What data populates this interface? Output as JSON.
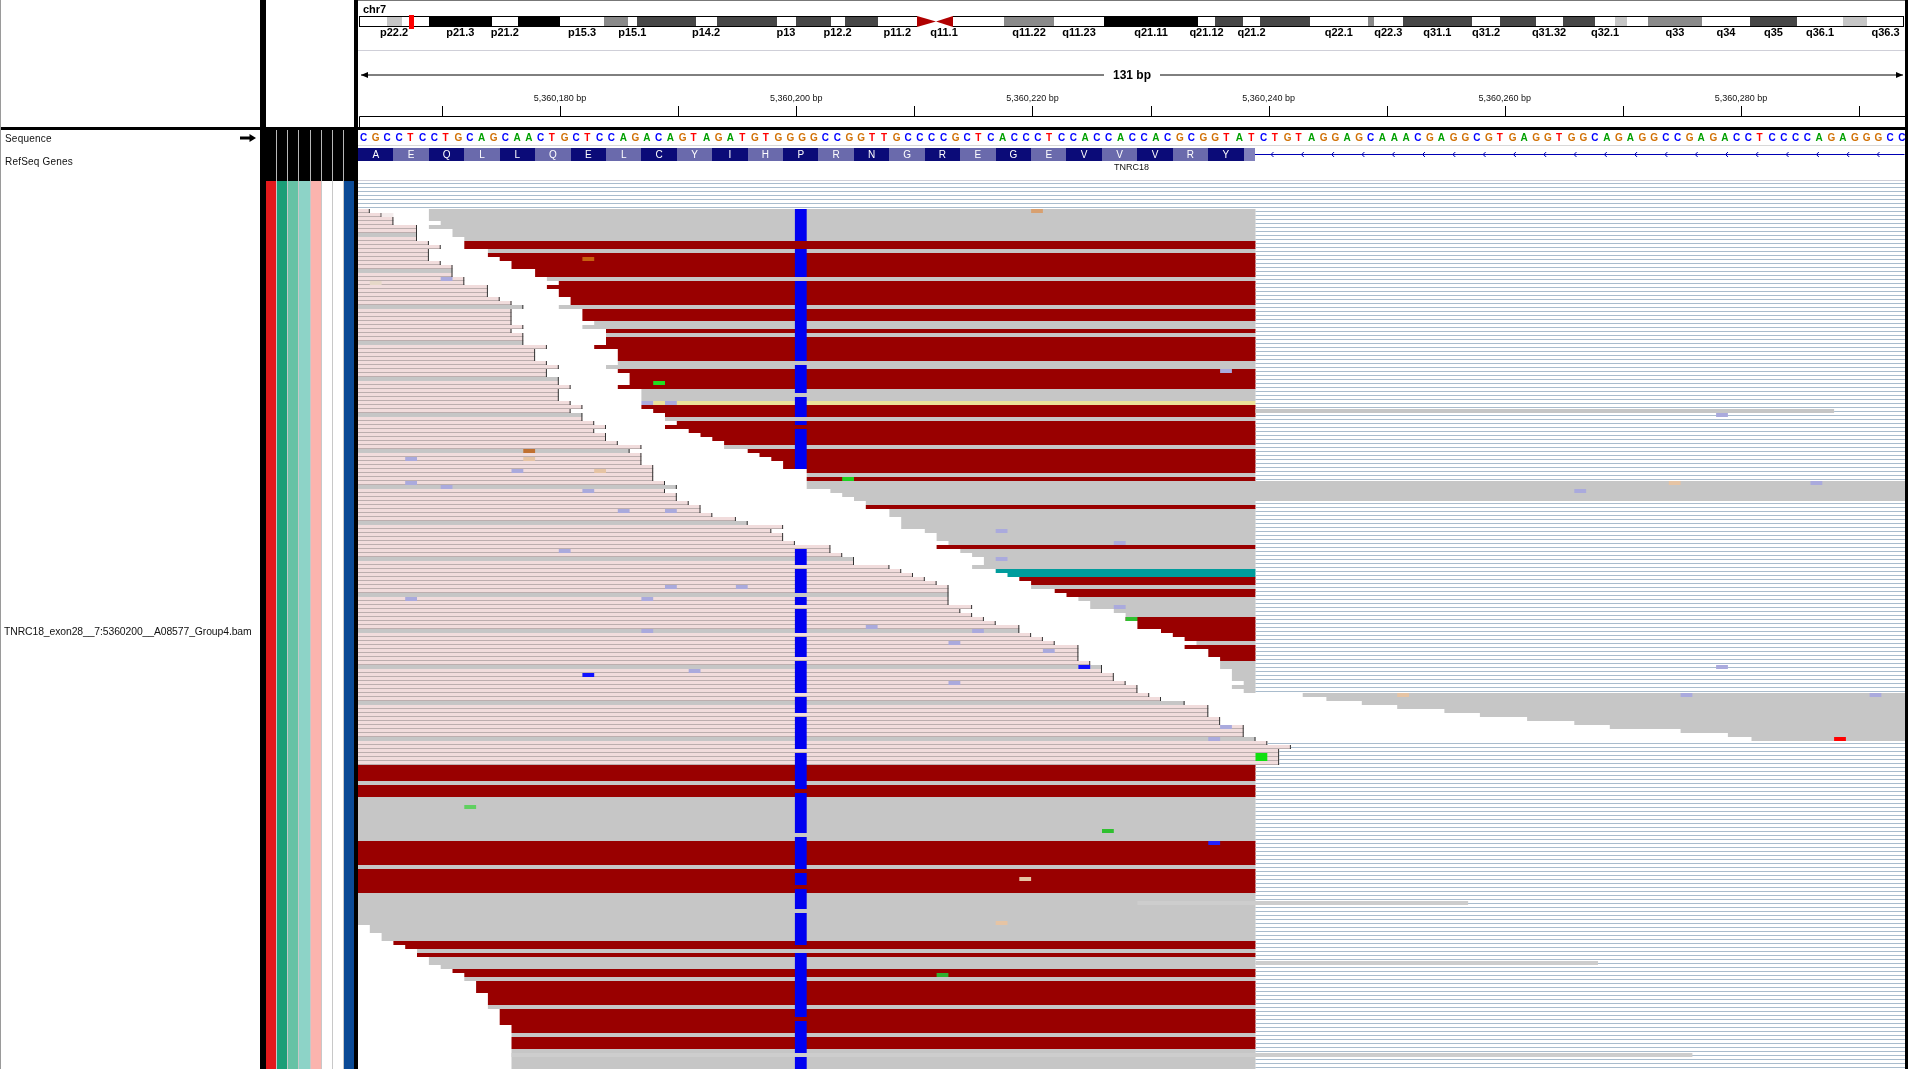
{
  "ideogram": {
    "chromosome": "chr7",
    "bands": [
      {
        "kind": "gneg"
      },
      {
        "kind": "gpos25",
        "label": "p22.2"
      },
      {
        "kind": "gneg"
      },
      {
        "kind": "gpos100",
        "label": "p21.3"
      },
      {
        "kind": "gneg",
        "label": "p21.2"
      },
      {
        "kind": "gpos100"
      },
      {
        "kind": "gneg",
        "label": "p15.3"
      },
      {
        "kind": "gpos50"
      },
      {
        "kind": "gneg",
        "label": "p15.1"
      },
      {
        "kind": "gpos75"
      },
      {
        "kind": "gneg",
        "label": "p14.2"
      },
      {
        "kind": "gpos75"
      },
      {
        "kind": "gneg",
        "label": "p13"
      },
      {
        "kind": "gpos75"
      },
      {
        "kind": "gneg",
        "label": "p12.2"
      },
      {
        "kind": "gpos75"
      },
      {
        "kind": "gneg",
        "label": "p11.2"
      },
      {
        "kind": "acen"
      },
      {
        "kind": "acen",
        "label": "q11.1"
      },
      {
        "kind": "gneg"
      },
      {
        "kind": "gpos50",
        "label": "q11.22"
      },
      {
        "kind": "gneg",
        "label": "q11.23"
      },
      {
        "kind": "gpos100",
        "label": "q21.11"
      },
      {
        "kind": "gneg",
        "label": "q21.12"
      },
      {
        "kind": "gpos75"
      },
      {
        "kind": "gneg",
        "label": "q21.2"
      },
      {
        "kind": "gpos75"
      },
      {
        "kind": "gneg",
        "label": "q22.1"
      },
      {
        "kind": "gpos50"
      },
      {
        "kind": "gneg",
        "label": "q22.3"
      },
      {
        "kind": "gpos75",
        "label": "q31.1"
      },
      {
        "kind": "gneg",
        "label": "q31.2"
      },
      {
        "kind": "gpos75"
      },
      {
        "kind": "gneg",
        "label": "q31.32"
      },
      {
        "kind": "gpos75"
      },
      {
        "kind": "gneg",
        "label": "q32.1"
      },
      {
        "kind": "gpos25"
      },
      {
        "kind": "gneg"
      },
      {
        "kind": "gpos50",
        "label": "q33"
      },
      {
        "kind": "gneg",
        "label": "q34"
      },
      {
        "kind": "gpos75",
        "label": "q35"
      },
      {
        "kind": "gneg",
        "label": "q36.1"
      },
      {
        "kind": "gpos25"
      },
      {
        "kind": "gneg",
        "label": "q36.3"
      }
    ]
  },
  "ruler": {
    "span": "131 bp",
    "tick_labels": [
      "5,360,180 bp",
      "5,360,200 bp",
      "5,360,220 bp",
      "5,360,240 bp",
      "5,360,260 bp",
      "5,360,280 bp"
    ]
  },
  "tracks": {
    "sequence": {
      "name": "Sequence",
      "reverse_strand": false,
      "bases": "CGCCTCCTGCAGCAACTGCTCCAGACAGTAGATGTGGGGCCGGTTGCCCCGCTCACCCTCCACCACCACGCGGTATCTGTAGGAGCAAACGAGGCGTGAGGTGGCAGAGGCCGAGACCTCCCCAGAGGGCC"
    },
    "refseq_genes": {
      "name": "RefSeq Genes",
      "reverse_strand": true,
      "amino_acids": [
        "A",
        "E",
        "Q",
        "L",
        "L",
        "Q",
        "E",
        "L",
        "C",
        "Y",
        "I",
        "H",
        "P",
        "R",
        "N",
        "G",
        "R",
        "E",
        "G",
        "E",
        "V",
        "V",
        "V",
        "R",
        "Y"
      ],
      "gene_label": "TNRC18"
    },
    "alignment": {
      "name": "TNRC18_exon28__7:5360200__A08577_Group4.bam",
      "attributes": [
        {
          "color": "#e31a1c"
        },
        {
          "color": "#1b9e77"
        },
        {
          "color": "#66c2a5"
        },
        {
          "color": "#8dd3c7"
        },
        {
          "color": "#fbb4ae"
        },
        {
          "color": "#ffffff"
        },
        {
          "color": "#ffffff"
        },
        {
          "color": "#0b4a96"
        }
      ]
    }
  }
}
